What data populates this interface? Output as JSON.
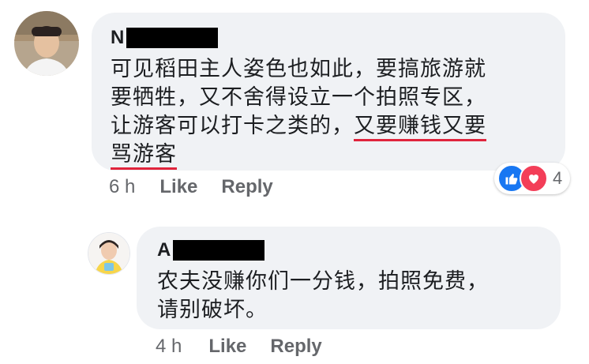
{
  "comment": {
    "author_initial": "N",
    "body_lines": [
      "可见稻田主人姿色也如此，要搞旅游就",
      "要牺牲，又不舍得设立一个拍照专区，",
      "让游客可以打卡之类的，"
    ],
    "body_underlined_a": "又要赚钱又要",
    "body_underlined_b": "骂游客",
    "time": "6 h",
    "like_label": "Like",
    "reply_label": "Reply",
    "reaction_count": "4",
    "reaction_icons": [
      "like-icon",
      "love-icon"
    ]
  },
  "reply": {
    "author_initial": "A",
    "body_lines": [
      "农夫没赚你们一分钱，拍照免费，",
      "请别破坏。"
    ],
    "time": "4 h",
    "like_label": "Like",
    "reply_label": "Reply"
  },
  "colors": {
    "bubble": "#f0f2f5",
    "underline": "#e0243c",
    "like_blue": "#1877f2",
    "love_red": "#f33e58",
    "meta_gray": "#65676b"
  }
}
